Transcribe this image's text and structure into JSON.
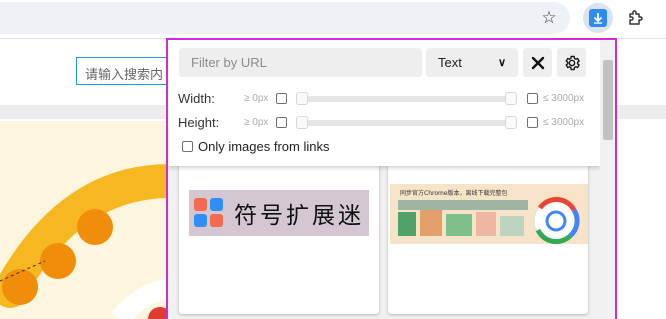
{
  "browser": {
    "bookmark_icon": "star-icon",
    "extension_icon": "download-arrow-icon",
    "extensions_menu_icon": "puzzle-icon",
    "accent": "#2e8bf0"
  },
  "page": {
    "search_placeholder": "请输入搜索内"
  },
  "popup": {
    "border_color": "#d42ad6",
    "filter": {
      "placeholder": "Filter by URL",
      "value": ""
    },
    "type_select": {
      "selected": "Text"
    },
    "close_icon": "close-x-icon",
    "settings_icon": "gear-icon",
    "width": {
      "label": "Width:",
      "min_label": "≥ 0px",
      "max_label": "≤ 3000px",
      "min_checked": false,
      "max_checked": false
    },
    "height": {
      "label": "Height:",
      "min_label": "≥ 0px",
      "max_label": "≤ 3000px",
      "min_checked": false,
      "max_checked": false
    },
    "only_links": {
      "label": "Only images from links",
      "checked": false
    },
    "images": [
      {
        "alt_text": "符号扩展迷"
      },
      {
        "alt_text": "同步官方Chrome版本，离线下载完整包"
      }
    ]
  }
}
